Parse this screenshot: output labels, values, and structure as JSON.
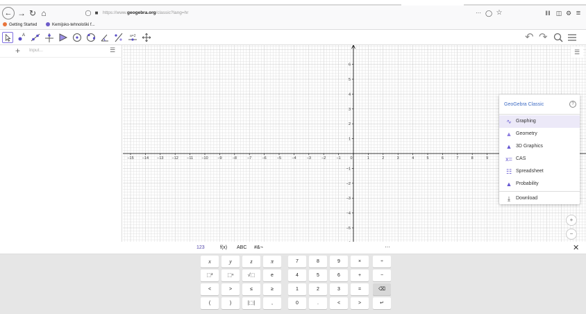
{
  "browser": {
    "url_prefix": "https://www.",
    "url_host": "geogebra.org",
    "url_path": "/classic?lang=hr",
    "more_glyph": "···",
    "bookmarks": [
      {
        "label": "Getting Started",
        "color": "#e8743b"
      },
      {
        "label": "Kemijsko-tehnološki f...",
        "color": "#6d5cc9"
      }
    ]
  },
  "algebra": {
    "input_placeholder": "Input...",
    "plus_glyph": "+",
    "menu_glyph": "☰"
  },
  "graph": {
    "x_ticks": [
      "-15",
      "-14",
      "-13",
      "-12",
      "-11",
      "-10",
      "-9",
      "-8",
      "-7",
      "-6",
      "-5",
      "-4",
      "-3",
      "-2",
      "-1",
      "0",
      "1",
      "2",
      "3",
      "4",
      "5",
      "6",
      "7",
      "8",
      "9",
      "10",
      "11",
      "12",
      "13",
      "14",
      "15"
    ],
    "y_ticks": [
      "6",
      "5",
      "4",
      "3",
      "2",
      "1",
      "-1",
      "-2",
      "-3",
      "-4",
      "-5",
      "-6"
    ],
    "axis_color": "#000000",
    "grid_color": "#e0e0e0",
    "major_grid_color": "#c8c8c8"
  },
  "app_picker": {
    "title": "GeoGebra Classic",
    "help_glyph": "?",
    "items": [
      {
        "label": "Graphing",
        "icon": "graphing-icon",
        "glyph": "∿",
        "color": "#6557d2"
      },
      {
        "label": "Geometry",
        "icon": "geometry-icon",
        "glyph": "▲",
        "color": "#8c7ce0"
      },
      {
        "label": "3D Graphics",
        "icon": "3d-graphics-icon",
        "glyph": "▲",
        "color": "#6557d2"
      },
      {
        "label": "CAS",
        "icon": "cas-icon",
        "glyph": "x=",
        "color": "#6557d2"
      },
      {
        "label": "Spreadsheet",
        "icon": "spreadsheet-icon",
        "glyph": "☷",
        "color": "#6557d2"
      },
      {
        "label": "Probability",
        "icon": "probability-icon",
        "glyph": "▲",
        "color": "#6557d2"
      },
      {
        "label": "Download",
        "icon": "download-icon",
        "glyph": "⤓",
        "color": "#444444"
      }
    ]
  },
  "zoom": {
    "in_glyph": "+",
    "out_glyph": "−"
  },
  "keyboard": {
    "tabs": [
      "123",
      "f(x)",
      "ABC",
      "#&¬"
    ],
    "more_glyph": "···",
    "close_glyph": "✕",
    "rows": [
      [
        "x",
        "y",
        "z",
        "π",
        "7",
        "8",
        "9",
        "×",
        "÷"
      ],
      [
        "⬚²",
        "⬚ⁿ",
        "√⬚",
        "e",
        "4",
        "5",
        "6",
        "+",
        "−"
      ],
      [
        "<",
        ">",
        "≤",
        "≥",
        "1",
        "2",
        "3",
        "=",
        "⌫"
      ],
      [
        "(",
        ")",
        "|⬚|",
        ",",
        "0",
        ".",
        "<",
        ">",
        "↵"
      ]
    ]
  }
}
